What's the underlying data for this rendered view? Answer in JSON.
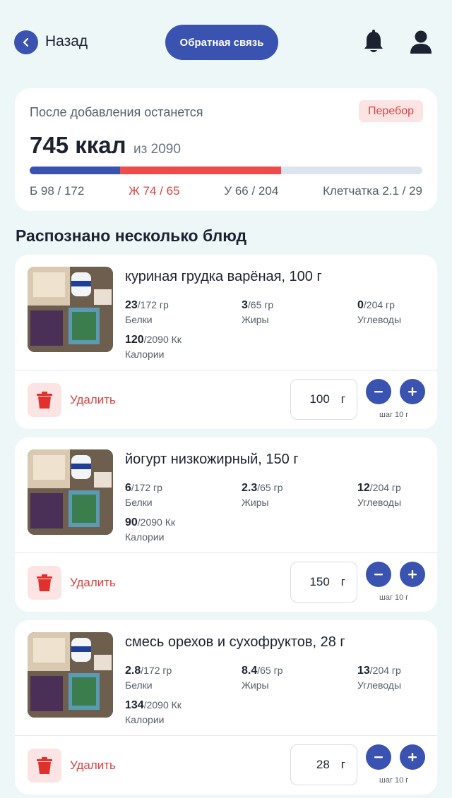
{
  "header": {
    "back_label": "Назад",
    "feedback_label": "Обратная связь"
  },
  "summary": {
    "caption": "После добавления останется",
    "badge": "Перебор",
    "kcal_value": "745 ккал",
    "kcal_of": "из 2090",
    "progress": {
      "protein_fraction": 0.23,
      "fat_fraction": 0.41
    },
    "macros": {
      "protein": "Б 98 / 172",
      "fat": "Ж 74 / 65",
      "carbs": "У 66 / 204",
      "fiber": "Клетчатка 2.1 / 29"
    }
  },
  "section_title": "Распознано несколько блюд",
  "labels": {
    "protein": "Белки",
    "fat": "Жиры",
    "carbs": "Углеводы",
    "calories": "Калории",
    "delete": "Удалить",
    "unit": "г",
    "step": "шаг 10 г"
  },
  "dishes": [
    {
      "name": "куриная грудка варёная, 100 г",
      "protein": "23",
      "protein_goal": "/172 гр",
      "fat": "3",
      "fat_goal": "/65 гр",
      "carbs": "0",
      "carbs_goal": "/204 гр",
      "kcal": "120",
      "kcal_goal": "/2090 Кк",
      "qty": "100"
    },
    {
      "name": "йогурт низкожирный, 150 г",
      "protein": "6",
      "protein_goal": "/172 гр",
      "fat": "2.3",
      "fat_goal": "/65 гр",
      "carbs": "12",
      "carbs_goal": "/204 гр",
      "kcal": "90",
      "kcal_goal": "/2090 Кк",
      "qty": "150"
    },
    {
      "name": "смесь орехов и сухофруктов, 28 г",
      "protein": "2.8",
      "protein_goal": "/172 гр",
      "fat": "8.4",
      "fat_goal": "/65 гр",
      "carbs": "13",
      "carbs_goal": "/204 гр",
      "kcal": "134",
      "kcal_goal": "/2090 Кк",
      "qty": "28"
    }
  ],
  "colors": {
    "accent": "#3a52b0",
    "danger": "#d9423e",
    "background": "#eef7f8"
  }
}
